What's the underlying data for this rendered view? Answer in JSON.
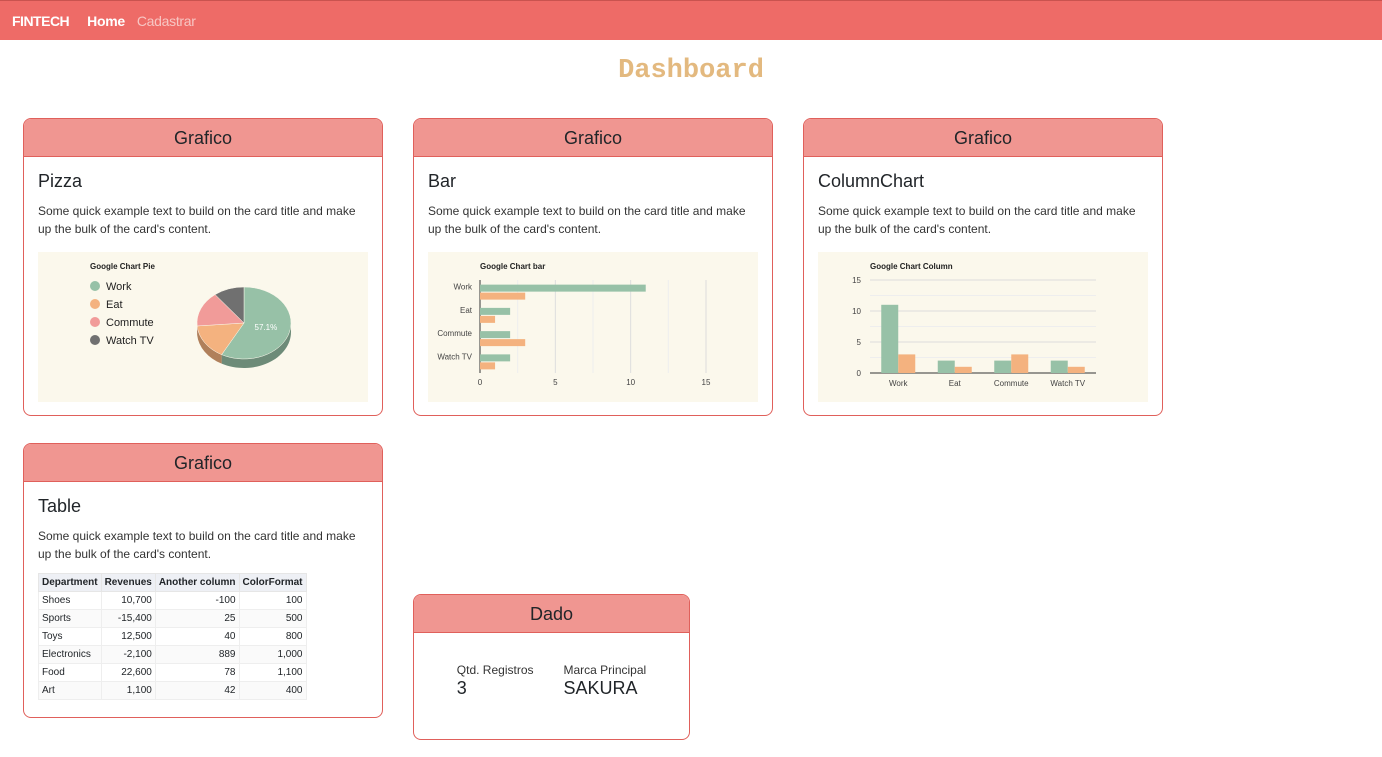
{
  "navbar": {
    "brand": "FINTECH",
    "links": [
      {
        "label": "Home",
        "active": true
      },
      {
        "label": "Cadastrar",
        "active": false
      }
    ]
  },
  "page": {
    "title": "Dashboard"
  },
  "colors": {
    "navbar": "#ee6b67",
    "card_header": "#f09691",
    "title": "#e3b97f",
    "series1": "#97c1a7",
    "series2": "#f4b27f",
    "series3": "#f19b99",
    "series4": "#707070"
  },
  "cards": [
    {
      "header": "Grafico",
      "title": "Pizza",
      "text": "Some quick example text to build on the card title and make up the bulk of the card's content.",
      "chart_data": {
        "type": "pie",
        "title": "Google Chart Pie",
        "labels": [
          "Work",
          "Eat",
          "Commute",
          "Watch TV"
        ],
        "values": [
          11,
          3,
          3,
          2
        ],
        "colors": [
          "#97c1a7",
          "#f4b27f",
          "#f19b99",
          "#707070"
        ],
        "slice_label": "57.1%",
        "is3D": true,
        "legend": "left"
      }
    },
    {
      "header": "Grafico",
      "title": "Bar",
      "text": "Some quick example text to build on the card title and make up the bulk of the card's content.",
      "chart_data": {
        "type": "bar",
        "orientation": "horizontal",
        "title": "Google Chart bar",
        "categories": [
          "Work",
          "Eat",
          "Commute",
          "Watch TV"
        ],
        "series": [
          {
            "values": [
              11,
              2,
              2,
              2
            ],
            "color": "#97c1a7"
          },
          {
            "values": [
              3,
              1,
              3,
              1
            ],
            "color": "#f4b27f"
          }
        ],
        "xlim": [
          0,
          15
        ],
        "ticks": [
          0,
          5,
          10,
          15
        ],
        "grid": true
      }
    },
    {
      "header": "Grafico",
      "title": "ColumnChart",
      "text": "Some quick example text to build on the card title and make up the bulk of the card's content.",
      "chart_data": {
        "type": "bar",
        "orientation": "vertical",
        "title": "Google Chart Column",
        "categories": [
          "Work",
          "Eat",
          "Commute",
          "Watch TV"
        ],
        "series": [
          {
            "values": [
              11,
              2,
              2,
              2
            ],
            "color": "#97c1a7"
          },
          {
            "values": [
              3,
              1,
              3,
              1
            ],
            "color": "#f4b27f"
          }
        ],
        "ylim": [
          0,
          15
        ],
        "ticks": [
          0,
          5,
          10,
          15
        ],
        "grid": true
      }
    },
    {
      "header": "Grafico",
      "title": "Table",
      "text": "Some quick example text to build on the card title and make up the bulk of the card's content.",
      "chart_data": {
        "type": "table",
        "columns": [
          "Department",
          "Revenues",
          "Another column",
          "ColorFormat"
        ],
        "rows": [
          [
            "Shoes",
            "10,700",
            "-100",
            "100"
          ],
          [
            "Sports",
            "-15,400",
            "25",
            "500"
          ],
          [
            "Toys",
            "12,500",
            "40",
            "800"
          ],
          [
            "Electronics",
            "-2,100",
            "889",
            "1,000"
          ],
          [
            "Food",
            "22,600",
            "78",
            "1,100"
          ],
          [
            "Art",
            "1,100",
            "42",
            "400"
          ]
        ]
      }
    }
  ],
  "dado": {
    "header": "Dado",
    "stats": [
      {
        "label": "Qtd. Registros",
        "value": "3"
      },
      {
        "label": "Marca Principal",
        "value": "SAKURA"
      }
    ]
  }
}
